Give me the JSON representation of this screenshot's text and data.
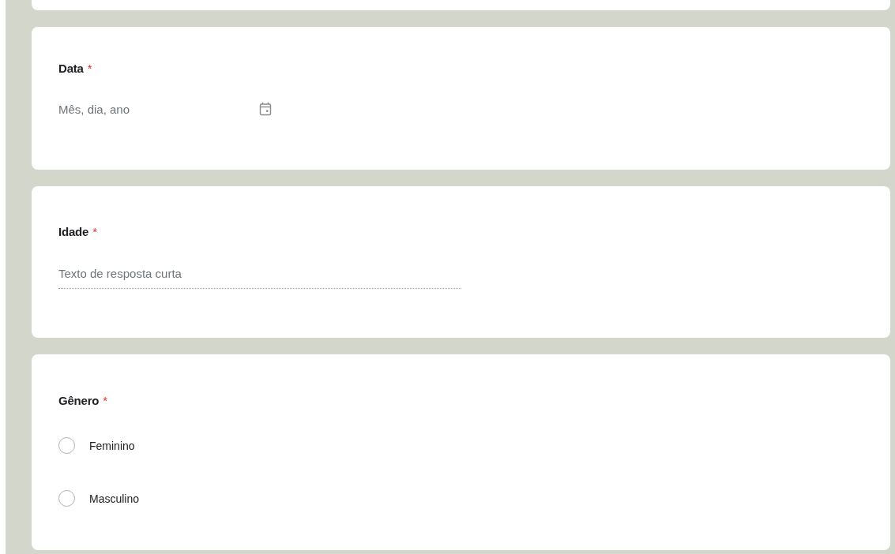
{
  "questions": [
    {
      "kind": "date",
      "title": "Data",
      "required_mark": "*",
      "placeholder": "Mês, dia, ano"
    },
    {
      "kind": "short_text",
      "title": "Idade",
      "required_mark": "*",
      "placeholder": "Texto de resposta curta"
    },
    {
      "kind": "radio",
      "title": "Gênero",
      "required_mark": "*",
      "options": [
        {
          "label": "Feminino",
          "selected": false
        },
        {
          "label": "Masculino",
          "selected": false
        }
      ]
    }
  ]
}
